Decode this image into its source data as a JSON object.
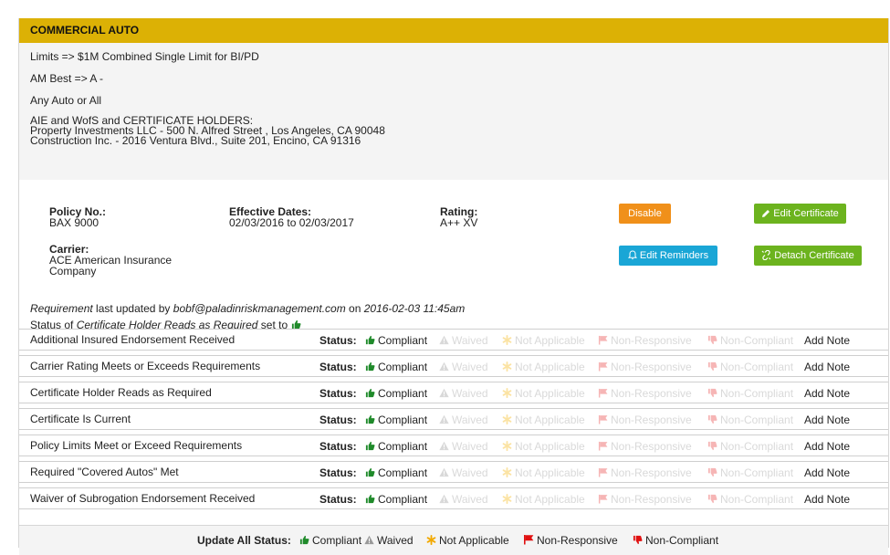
{
  "section": {
    "title": "COMMERCIAL AUTO"
  },
  "requirements": {
    "limits": "Limits => $1M Combined Single Limit for BI/PD",
    "am_best": "AM Best => A -",
    "autos": "Any Auto or All",
    "holders_title": "AIE and WofS and CERTIFICATE HOLDERS:",
    "holder_1": "Property Investments LLC - 500 N. Alfred Street , Los Angeles, CA 90048",
    "holder_2": "Construction Inc. - 2016 Ventura Blvd., Suite 201, Encino, CA 91316"
  },
  "policy": {
    "policy_no_label": "Policy No.:",
    "policy_no": "BAX 9000",
    "effective_label": "Effective Dates:",
    "effective": "02/03/2016 to 02/03/2017",
    "rating_label": "Rating:",
    "rating": "A++ XV",
    "carrier_label": "Carrier:",
    "carrier_line1": "ACE American Insurance",
    "carrier_line2": "Company"
  },
  "buttons": {
    "disable": "Disable",
    "edit_certificate": "Edit Certificate",
    "edit_reminders": "Edit Reminders",
    "detach_certificate": "Detach Certificate"
  },
  "update_note": {
    "req_word": "Requirement",
    "last_updated_by": " last updated by ",
    "user": "bobf@paladinriskmanagement.com",
    "on": " on ",
    "timestamp": "2016-02-03 11:45am",
    "status_of": "Status of ",
    "item": "Certificate Holder Reads as Required",
    "set_to": " set to "
  },
  "status_labels": {
    "status": "Status:",
    "compliant": "Compliant",
    "waived": "Waived",
    "not_applicable": "Not Applicable",
    "non_responsive": "Non-Responsive",
    "non_compliant": "Non-Compliant",
    "add_note": "Add Note"
  },
  "rows": [
    {
      "name": "Additional Insured Endorsement Received"
    },
    {
      "name": "Carrier Rating Meets or Exceeds Requirements"
    },
    {
      "name": "Certificate Holder Reads as Required"
    },
    {
      "name": "Certificate Is Current"
    },
    {
      "name": "Policy Limits Meet or Exceed Requirements"
    },
    {
      "name": "Required \"Covered Autos\" Met"
    },
    {
      "name": "Waiver of Subrogation Endorsement Received"
    }
  ],
  "update_all": {
    "label": "Update All Status:",
    "compliant": "Compliant",
    "waived": "Waived",
    "not_applicable": "Not Applicable",
    "non_responsive": "Non-Responsive",
    "non_compliant": "Non-Compliant"
  },
  "colors": {
    "header": "#dcb105",
    "compliant": "#1f8a2a",
    "waived": "#999999",
    "not_applicable": "#f2a900",
    "non_responsive": "#e01010",
    "non_compliant": "#e01010"
  },
  "icons": {
    "compliant": "thumbs-up-icon",
    "waived": "warning-icon",
    "not_applicable": "asterisk-icon",
    "non_responsive": "flag-icon",
    "non_compliant": "thumbs-down-icon",
    "edit": "pencil-icon",
    "reminders": "bell-icon",
    "detach": "unlink-icon"
  }
}
